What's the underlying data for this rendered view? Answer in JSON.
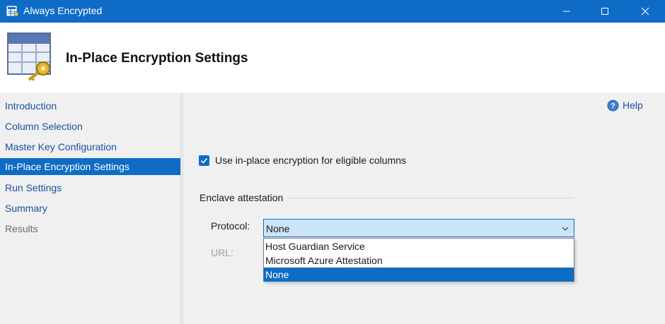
{
  "window": {
    "title": "Always Encrypted"
  },
  "header": {
    "heading": "In-Place Encryption Settings"
  },
  "sidebar": {
    "items": [
      {
        "label": "Introduction"
      },
      {
        "label": "Column Selection"
      },
      {
        "label": "Master Key Configuration"
      },
      {
        "label": "In-Place Encryption Settings"
      },
      {
        "label": "Run Settings"
      },
      {
        "label": "Summary"
      },
      {
        "label": "Results"
      }
    ]
  },
  "help": {
    "label": "Help"
  },
  "options": {
    "inplace_checkbox_label": "Use in-place encryption for eligible columns",
    "inplace_checked": true
  },
  "enclave": {
    "group_title": "Enclave attestation",
    "protocol_label": "Protocol:",
    "protocol_value": "None",
    "url_label": "URL:",
    "dropdown_options": [
      "Host Guardian Service",
      "Microsoft Azure Attestation",
      "None"
    ]
  },
  "colors": {
    "accent": "#0f6cc6",
    "link": "#1a4f9e",
    "panel": "#f0f0f0"
  },
  "icons": {
    "app": "table-key-icon",
    "help": "help-icon"
  }
}
